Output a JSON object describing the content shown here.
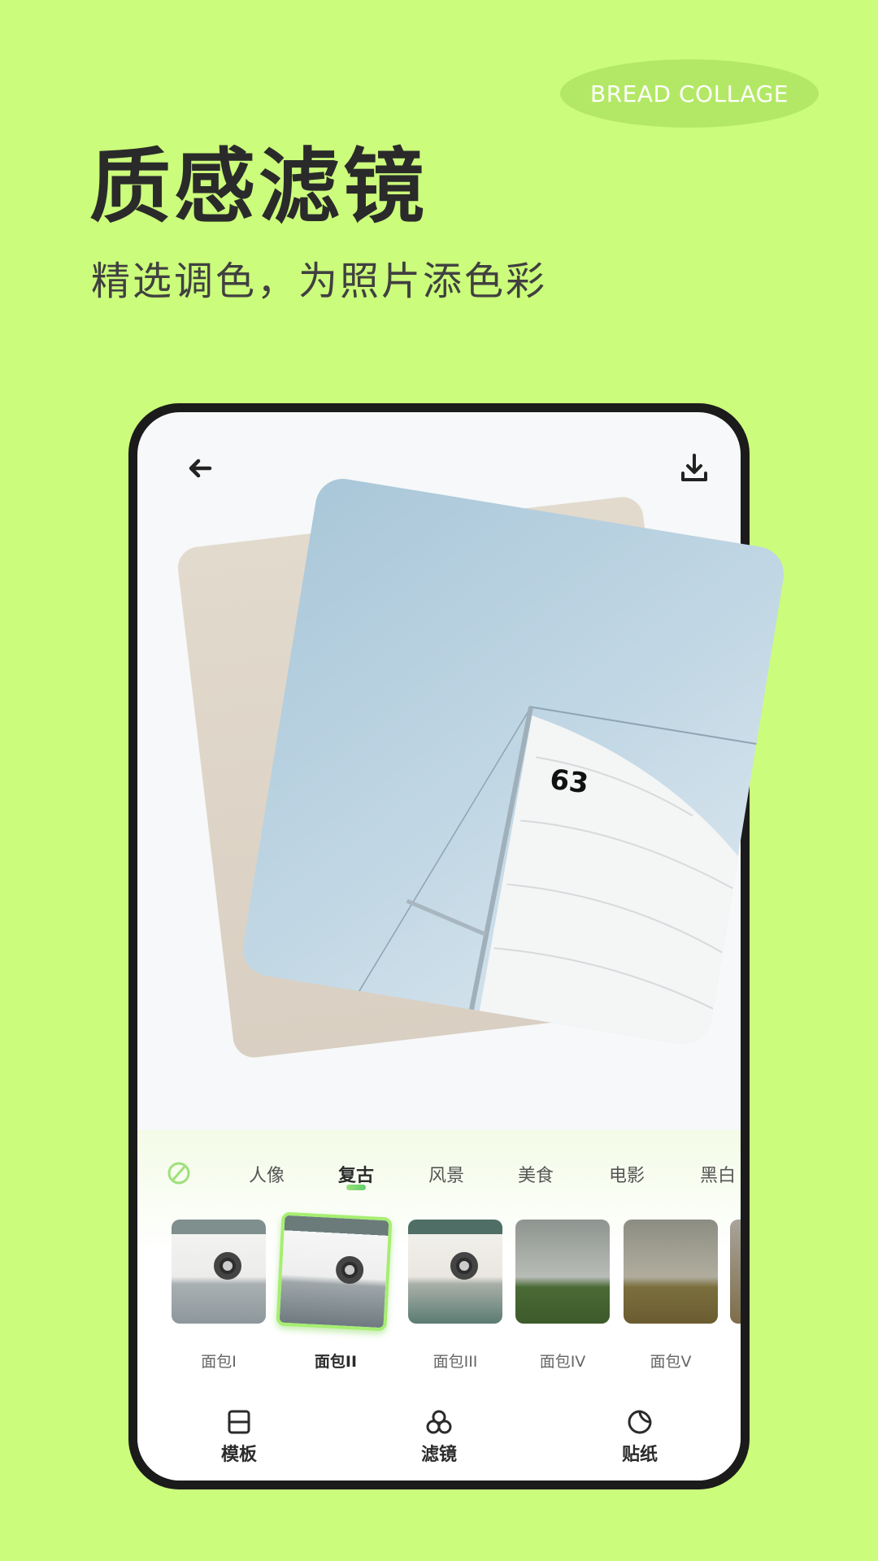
{
  "badge": "BREAD COLLAGE",
  "headline": "质感滤镜",
  "subheadline": "精选调色，为照片添色彩",
  "colors": {
    "background": "#cbfc7b",
    "badge": "#b3e866",
    "accent": "#a6ee72",
    "phone_frame": "#1b1b1b"
  },
  "phone": {
    "toolbar": {
      "back_icon": "arrow-left-icon",
      "download_icon": "download-icon"
    },
    "photo": {
      "sail_number": "63"
    },
    "filter_categories": {
      "none_icon": "no-filter-icon",
      "items": [
        "人像",
        "复古",
        "风景",
        "美食",
        "电影",
        "黑白"
      ],
      "selected": "复古"
    },
    "filters": {
      "items": [
        "面包I",
        "面包II",
        "面包III",
        "面包IV",
        "面包V"
      ],
      "selected": "面包II"
    },
    "bottom_nav": [
      {
        "label": "模板",
        "icon": "template-icon"
      },
      {
        "label": "滤镜",
        "icon": "filter-icon",
        "active": true
      },
      {
        "label": "贴纸",
        "icon": "sticker-icon"
      }
    ]
  }
}
